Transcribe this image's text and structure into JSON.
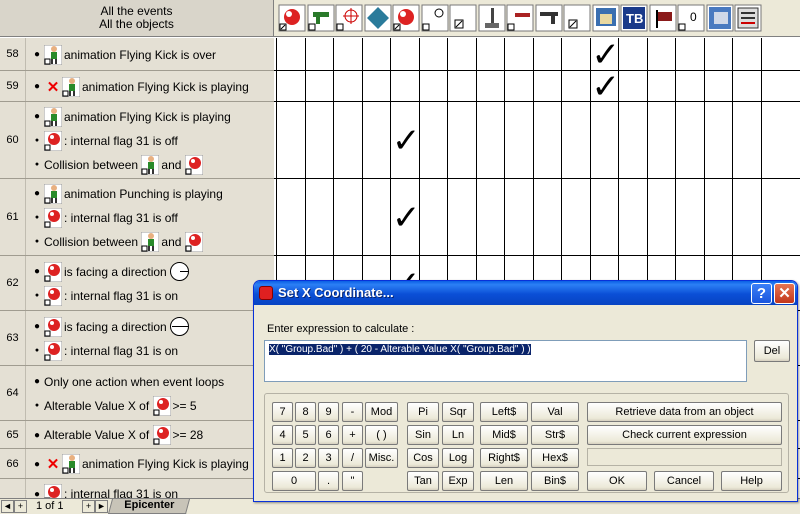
{
  "header": {
    "line1": "All the events",
    "line2": "All the objects"
  },
  "object_icons": [
    "bomb-icon",
    "gun-icon",
    "crosshair-icon",
    "diamond-icon",
    "bomb-icon",
    "position-icon",
    "small-box-icon",
    "joystick-icon",
    "whistle-icon",
    "pistol-icon",
    "small-box-icon",
    "storyboard-icon",
    "text-icon",
    "flag-icon",
    "counter-icon",
    "palette-icon",
    "list-icon"
  ],
  "events": [
    {
      "num": "58",
      "lines": [
        {
          "text": "animation Flying Kick is over"
        }
      ]
    },
    {
      "num": "59",
      "lines": [
        {
          "text": "animation Flying Kick is playing"
        }
      ]
    },
    {
      "num": "60",
      "lines": [
        {
          "text": "animation Flying Kick is playing"
        },
        {
          "text": ": internal flag 31 is off"
        },
        {
          "pre": "Collision between",
          "mid": "and"
        }
      ]
    },
    {
      "num": "61",
      "lines": [
        {
          "text": "animation Punching is playing"
        },
        {
          "text": ": internal flag 31 is off"
        },
        {
          "pre": "Collision between",
          "mid": "and"
        }
      ]
    },
    {
      "num": "62",
      "lines": [
        {
          "text": "is facing a direction"
        },
        {
          "text": ": internal flag 31 is on"
        }
      ]
    },
    {
      "num": "63",
      "lines": [
        {
          "text": "is facing a direction"
        },
        {
          "text": ": internal flag 31 is on"
        }
      ]
    },
    {
      "num": "64",
      "lines": [
        {
          "text": "Only one action when event loops"
        },
        {
          "pre": "Alterable Value X of",
          "post": ">= 5"
        }
      ]
    },
    {
      "num": "65",
      "lines": [
        {
          "pre": "Alterable Value X of",
          "post": ">= 28"
        }
      ]
    },
    {
      "num": "66",
      "lines": [
        {
          "text": "animation Flying Kick is playing"
        }
      ]
    },
    {
      "num": "",
      "lines": [
        {
          "text": ": internal flag 31 is on"
        }
      ]
    }
  ],
  "checkmark": "✓",
  "bottom": {
    "page": "1 of 1",
    "tab": "Epicenter",
    "nav_first": "◄",
    "nav_add": "+",
    "nav_next": "+",
    "nav_last": "►"
  },
  "dialog": {
    "title": "Set X Coordinate...",
    "help": "?",
    "close": "✕",
    "prompt": "Enter expression to calculate :",
    "expression": "X( \"Group.Bad\" ) + ( 20 - Alterable Value X( \"Group.Bad\" ) )",
    "del": "Del",
    "keypad": [
      "7",
      "8",
      "9",
      "-",
      "Mod",
      "4",
      "5",
      "6",
      "+",
      "( )",
      "1",
      "2",
      "3",
      "/",
      "Misc.",
      "0",
      ".",
      "\""
    ],
    "functions": [
      "Pi",
      "Sqr",
      "Left$",
      "Val",
      "Sin",
      "Ln",
      "Mid$",
      "Str$",
      "Cos",
      "Log",
      "Right$",
      "Hex$",
      "Tan",
      "Exp",
      "Len",
      "Bin$"
    ],
    "retrieve": "Retrieve data from an object",
    "check": "Check current expression",
    "ok": "OK",
    "cancel": "Cancel",
    "helpbtn": "Help"
  }
}
